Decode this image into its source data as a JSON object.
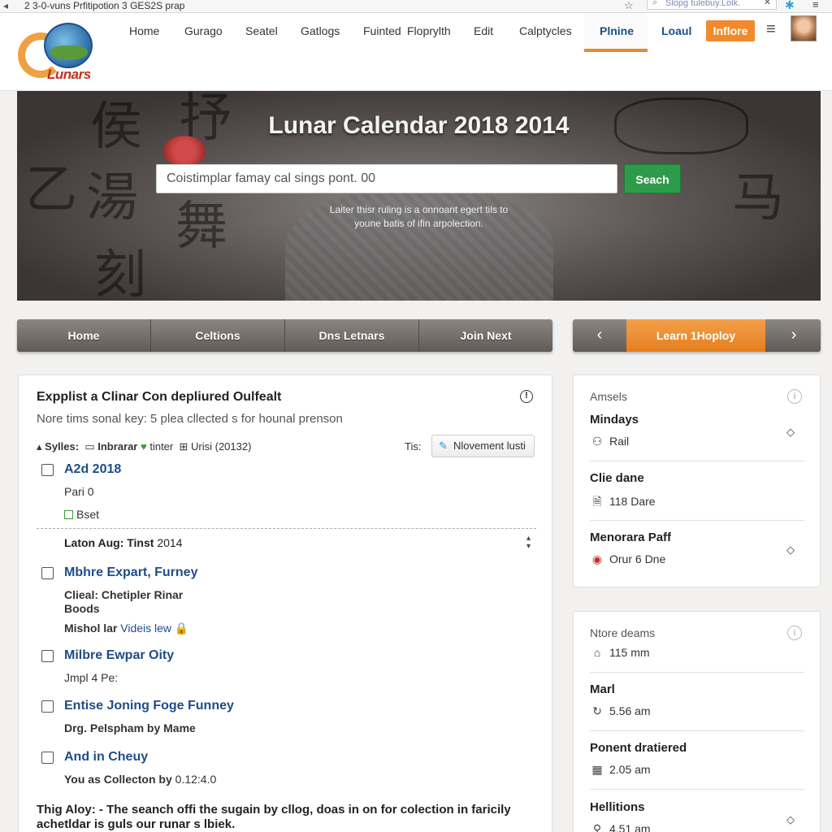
{
  "browser": {
    "tab_title": "2 3-0-vuns   Prfitipotion 3 GES2S prap",
    "url_placeholder": "Slopg tulebuy.Lolk."
  },
  "header": {
    "logo_text": "Lunars",
    "nav": [
      "Home",
      "Gurago",
      "Seatel",
      "Gatlogs",
      "Fuinted",
      "Floprylth",
      "Edit",
      "Calptycles",
      "Plnine"
    ],
    "load_label": "Loaul",
    "cta_label": "Inflore"
  },
  "hero": {
    "title": "Lunar Calendar 2018 2014",
    "search_value": "Coistimplar famay cal sings pont. 00",
    "search_button": "Seach",
    "subtitle_line1": "Laiter thisr ruling is a onnoant egert tils to",
    "subtitle_line2": "youne batis of ifin arpolection."
  },
  "tabs": [
    "Home",
    "Celtions",
    "Dns Letnars",
    "Join Next"
  ],
  "pager": {
    "prev": "‹",
    "label": "Learn 1Hoploy",
    "next": "›"
  },
  "main": {
    "title": "Expplist a Clinar Con depliured Oulfealt",
    "description": "Nore tims sonal key: 5 plea cllected s for hounal prenson",
    "filters": {
      "syles": "Sylles:",
      "inbrarar": "Inbrarar",
      "tinter": "tinter",
      "count": "Urisi (20132)"
    },
    "tips_label": "Tis:",
    "tips_button": "Nlovement lusti",
    "group1": {
      "title": "A2d 2018",
      "line1": "Pari 0",
      "line2": "Bset"
    },
    "section_label": "Laton Aug: Tinst",
    "section_year": "2014",
    "items": [
      {
        "title": "Mbhre Expart, Furney",
        "line1": "Clieal: Chetipler Rinar",
        "line2": "Boods",
        "line3a": "Mishol lar",
        "line3b": "Videis lew"
      },
      {
        "title": "Milbre Ewpar Oity",
        "line1": "Jmpl 4 Pe:"
      },
      {
        "title": "Entise Joning Foge Funney",
        "line1": "Drg. Pelspham by Mame"
      },
      {
        "title": "And in Cheuy",
        "line1": "You as Collecton by",
        "line1b": "0.12:4.0"
      }
    ],
    "footer_line1": "Thig Aloy: - The seanch offi the sugain by cllog, doas in on for colection in faricily",
    "footer_line2": "achetldar is guls our runar s lbiek."
  },
  "side1": {
    "heading": "Amsels",
    "rows": [
      {
        "name": "Mindays",
        "value": "Rail",
        "icon": "person-icon"
      },
      {
        "name": "Clie dane",
        "value": "118 Dare",
        "icon": "document-icon"
      },
      {
        "name": "Menorara Paff",
        "value": "Orur 6 Dne",
        "icon": "record-icon"
      }
    ]
  },
  "side2": {
    "heading": "Ntore deams",
    "first_value": "115 mm",
    "rows": [
      {
        "name": "Marl",
        "value": "5.56 am",
        "icon": "curl-icon"
      },
      {
        "name": "Ponent dratiered",
        "value": "2.05 am",
        "icon": "calendar-icon"
      },
      {
        "name": "Hellitions",
        "value": "4.51 am",
        "icon": "pin-icon"
      }
    ]
  },
  "colors": {
    "accent_orange": "#f08a2c",
    "link_blue": "#1e4d86",
    "search_green": "#2e9b4a"
  }
}
